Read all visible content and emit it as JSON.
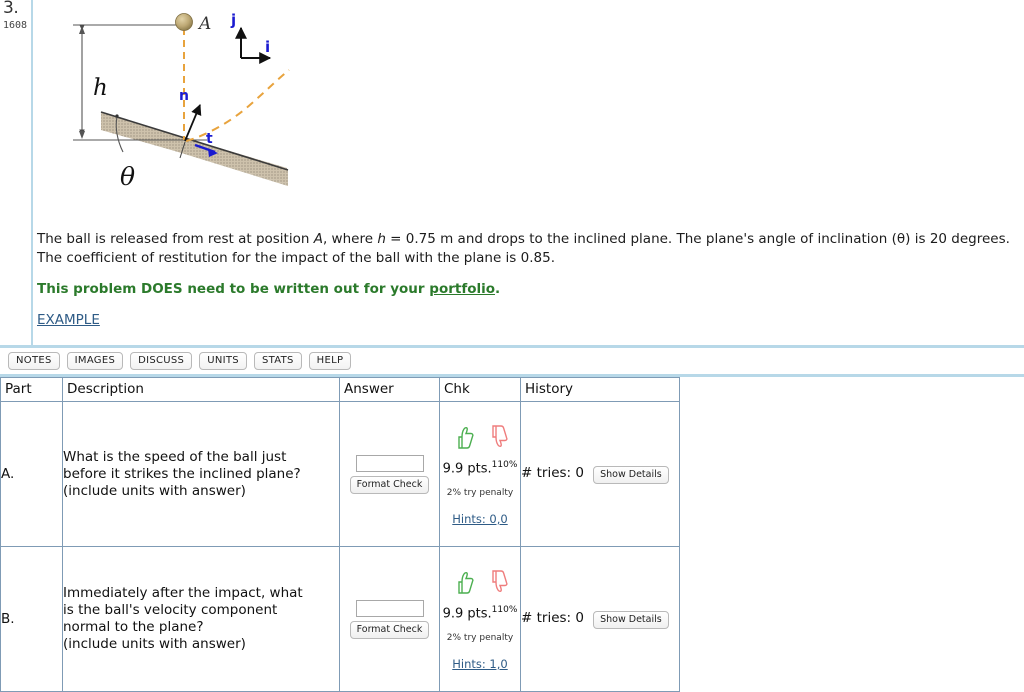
{
  "problem": {
    "number": "3.",
    "id": "1608",
    "statement_parts": {
      "t1": "The ball is released from rest at position ",
      "a": "A",
      "t2": ", where ",
      "h": "h",
      "t3": " = 0.75 m and drops to the inclined plane. The plane's angle of inclination (θ) is 20 degrees. The coefficient of restitution for the impact of the ball with the plane is 0.85.",
      "portfolio_prefix": "This problem DOES need to be written out for your ",
      "portfolio_link": "portfolio",
      "portfolio_suffix": ".",
      "example_link": "EXAMPLE"
    },
    "figure": {
      "label_A": "A",
      "label_h": "h",
      "label_theta": "θ",
      "label_n": "n",
      "label_t": "t",
      "label_i": "i",
      "label_j": "j",
      "colors": {
        "trajectory": "#e8a33d",
        "vector": "#1a1ad0",
        "ball": "#b59a5e",
        "incline": "#b9ab93"
      }
    }
  },
  "toolbar": {
    "buttons": [
      {
        "label": "NOTES",
        "name": "notes-button"
      },
      {
        "label": "IMAGES",
        "name": "images-button"
      },
      {
        "label": "DISCUSS",
        "name": "discuss-button"
      },
      {
        "label": "UNITS",
        "name": "units-button"
      },
      {
        "label": "STATS",
        "name": "stats-button"
      },
      {
        "label": "HELP",
        "name": "help-button"
      }
    ]
  },
  "table": {
    "headers": {
      "part": "Part",
      "description": "Description",
      "answer": "Answer",
      "chk": "Chk",
      "history": "History"
    },
    "rows": [
      {
        "part": "A.",
        "description_lines": [
          "What is the speed of the ball just",
          "before it strikes the inclined plane?",
          "(include units with answer)"
        ],
        "answer_value": "",
        "answer_placeholder": "",
        "format_check_label": "Format Check",
        "points": "9.9 pts.",
        "percent": "110%",
        "penalty": "2% try penalty",
        "hints": "Hints: 0,0",
        "tries": "# tries: 0",
        "show_details_label": "Show Details"
      },
      {
        "part": "B.",
        "description_lines": [
          "Immediately after the impact, what",
          "is the ball's velocity component",
          "normal to the plane?",
          "(include units with answer)"
        ],
        "answer_value": "",
        "answer_placeholder": "",
        "format_check_label": "Format Check",
        "points": "9.9 pts.",
        "percent": "110%",
        "penalty": "2% try penalty",
        "hints": "Hints: 1,0",
        "tries": "# tries: 0",
        "show_details_label": "Show Details"
      }
    ]
  },
  "colors": {
    "rule": "#b7d8e8",
    "table_border": "#7f9bb5",
    "link": "#2e5b86",
    "note_green": "#2b7a2b"
  }
}
